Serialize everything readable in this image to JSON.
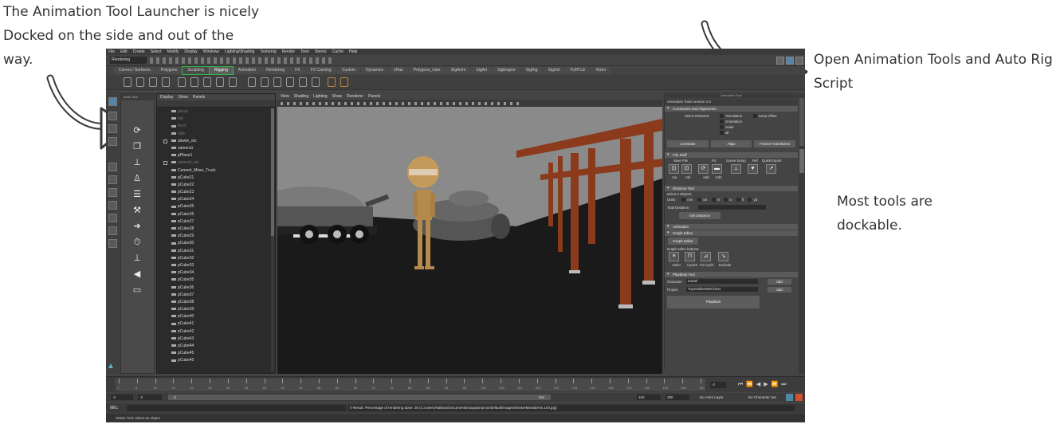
{
  "annotations": {
    "left": "The Animation Tool Launcher is nicely Docked on the side and out of the way.",
    "right": "Open Animation Tools and Auto Rig Script",
    "dock": "Most tools are dockable."
  },
  "menubar": [
    "File",
    "Edit",
    "Create",
    "Select",
    "Modify",
    "Display",
    "Windows",
    "Lighting/Shading",
    "Texturing",
    "Render",
    "Toon",
    "Stereo",
    "Cache",
    "Help"
  ],
  "mode": "Rendering",
  "shelf_tabs": [
    "Curves / Surfaces",
    "Polygons",
    "Sculpting",
    "Rigging",
    "Animation",
    "Rendering",
    "FX",
    "FX Caching",
    "Custom",
    "Dynamics",
    "nHair",
    "Polygons_User",
    "SigAnim",
    "SigArt",
    "SigEngine",
    "SigRig",
    "SigUtil",
    "TURTLE",
    "XGen"
  ],
  "anim_tool_title": "Anim Tool",
  "outliner": {
    "menu": [
      "Display",
      "Show",
      "Panels"
    ],
    "rows": [
      {
        "label": "persp",
        "dim": true
      },
      {
        "label": "top",
        "dim": true
      },
      {
        "label": "front",
        "dim": true
      },
      {
        "label": "side",
        "dim": true
      },
      {
        "label": "stewie_etc",
        "dim": false,
        "exp": true
      },
      {
        "label": "camera1",
        "dim": false
      },
      {
        "label": "pPlane1",
        "dim": false
      },
      {
        "label": "aniwork_etc",
        "dim": true,
        "exp": true
      },
      {
        "label": "Cement_Mixer_Truck",
        "dim": false
      },
      {
        "label": "pCube21",
        "dim": false
      },
      {
        "label": "pCube22",
        "dim": false
      },
      {
        "label": "pCube23",
        "dim": false
      },
      {
        "label": "pCube24",
        "dim": false
      },
      {
        "label": "pCube25",
        "dim": false
      },
      {
        "label": "pCube26",
        "dim": false
      },
      {
        "label": "pCube27",
        "dim": false
      },
      {
        "label": "pCube28",
        "dim": false
      },
      {
        "label": "pCube29",
        "dim": false
      },
      {
        "label": "pCube30",
        "dim": false
      },
      {
        "label": "pCube31",
        "dim": false
      },
      {
        "label": "pCube32",
        "dim": false
      },
      {
        "label": "pCube33",
        "dim": false
      },
      {
        "label": "pCube34",
        "dim": false
      },
      {
        "label": "pCube35",
        "dim": false
      },
      {
        "label": "pCube36",
        "dim": false
      },
      {
        "label": "pCube37",
        "dim": false
      },
      {
        "label": "pCube38",
        "dim": false
      },
      {
        "label": "pCube39",
        "dim": false
      },
      {
        "label": "pCube40",
        "dim": false
      },
      {
        "label": "pCube41",
        "dim": false
      },
      {
        "label": "pCube42",
        "dim": false
      },
      {
        "label": "pCube43",
        "dim": false
      },
      {
        "label": "pCube44",
        "dim": false
      },
      {
        "label": "pCube45",
        "dim": false
      },
      {
        "label": "pCube46",
        "dim": false
      }
    ]
  },
  "viewport_menu": [
    "View",
    "Shading",
    "Lighting",
    "Show",
    "Renderer",
    "Panels"
  ],
  "tool_panel": {
    "title": "Animation Tool",
    "version": "Animation Tools version 1.0",
    "constraints": {
      "header": "Constraints and Alignments",
      "select_relevant": "Select Relevant:",
      "options": [
        "Translation",
        "Orientation",
        "Scale",
        "all"
      ],
      "keep_offset": "Keep Offset",
      "buttons": [
        "Constrain",
        "Align",
        "Freeze Transforms"
      ]
    },
    "file_stuff": {
      "header": "File Stuff",
      "labels": [
        "Save File",
        "P4",
        "Scene Setup",
        "Ref",
        "Quick Export"
      ],
      "icon_labels": [
        ".ma",
        ".mb",
        "Add",
        "Edit"
      ]
    },
    "distance": {
      "header": "Distance Tool",
      "hint": "select 2 Objects",
      "units_label": "Units:",
      "units": [
        "mm",
        "cm",
        "m",
        "in",
        "ft",
        "yd"
      ],
      "total": "Total Distance:",
      "button": "Get Distance"
    },
    "animation": {
      "header": "Animation",
      "graph_header": "Graph Editor",
      "graph_button": "Graph Editor",
      "graph_buttons_label": "Graph editor buttons:",
      "icon_labels": [
        "Euler",
        "Cycles",
        "Fix Cycle",
        "Exclude"
      ]
    },
    "playblast": {
      "header": "Playblast Tool",
      "character_label": "Character",
      "character_value": "Kaisel",
      "project_label": "Project",
      "project_value": "ToySoldierWarChest",
      "add": "add",
      "button": "PlayBlast"
    }
  },
  "dock_tabs": [
    "Channel Box / Layer Editor",
    "Animation Tool"
  ],
  "timeline": {
    "ticks": [
      "1",
      "5",
      "10",
      "15",
      "20",
      "25",
      "30",
      "35",
      "40",
      "45",
      "50",
      "55",
      "60",
      "65",
      "70",
      "75",
      "80",
      "85",
      "90",
      "95",
      "100",
      "105",
      "110",
      "115",
      "120",
      "125",
      "130",
      "135",
      "140",
      "145",
      "150",
      "155",
      "160"
    ],
    "current": "-2"
  },
  "range": {
    "start": "-2",
    "start2": "-2",
    "slider_start": "-2",
    "slider_end": "163",
    "end": "163",
    "end2": "200",
    "anim_layer": "No Anim Layer",
    "char_set": "No Character Set"
  },
  "cmdline": {
    "label": "MEL",
    "result": "// Result: Percentage of rendering done: 35 (C:/Users/Nathan/Documents/maya/projects/default/images/StewieMartialArts.104.jpg)"
  },
  "helpline": "Select Tool: select an object"
}
